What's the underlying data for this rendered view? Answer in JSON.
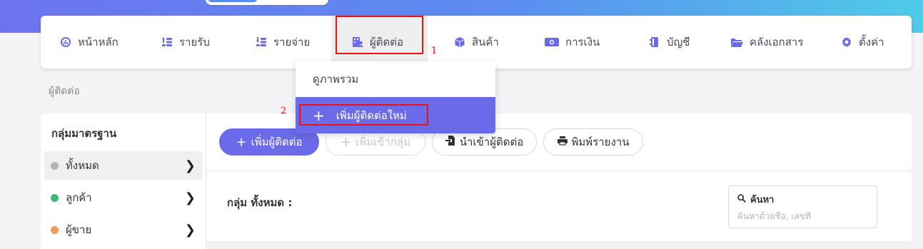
{
  "nav": {
    "items": [
      {
        "icon": "dashboard-icon",
        "label": "หน้าหลัก"
      },
      {
        "icon": "income-icon",
        "label": "รายรับ"
      },
      {
        "icon": "expense-icon",
        "label": "รายจ่าย"
      },
      {
        "icon": "contacts-icon",
        "label": "ผู้ติดต่อ"
      },
      {
        "icon": "product-box-icon",
        "label": "สินค้า"
      },
      {
        "icon": "money-icon",
        "label": "การเงิน"
      },
      {
        "icon": "ledger-icon",
        "label": "บัญชี"
      },
      {
        "icon": "folder-icon",
        "label": "คลังเอกสาร"
      },
      {
        "icon": "gear-icon",
        "label": "ตั้งค่า"
      }
    ],
    "active_index": 3
  },
  "dropdown": {
    "overview": "ดูภาพรวม",
    "add_new": "เพิ่มผู้ติดต่อใหม่",
    "add_icon": "+"
  },
  "annotations": {
    "step1": "1",
    "step2": "2",
    "color": "#e11111"
  },
  "breadcrumb": "ผู้ติดต่อ",
  "sidebar": {
    "title": "กลุ่มมาตรฐาน",
    "items": [
      {
        "label": "ทั้งหมด",
        "color": "#b4b4b4",
        "selected": true
      },
      {
        "label": "ลูกค้า",
        "color": "#3cba7a",
        "selected": false
      },
      {
        "label": "ผู้ขาย",
        "color": "#f59a4a",
        "selected": false
      }
    ]
  },
  "toolbar": {
    "add_contact": "เพิ่มผู้ติดต่อ",
    "add_to_group": "เพิ่มเข้ากลุ่ม",
    "import_contacts": "นำเข้าผู้ติดต่อ",
    "print_report": "พิมพ์รายงาน"
  },
  "group_label": "กลุ่ม ทั้งหมด :",
  "search": {
    "label": "ค้นหา",
    "placeholder": "ค้นหาด้วยชื่อ, เลขที่"
  },
  "colors": {
    "accent": "#6b6ae8",
    "header_start": "#6d73f0",
    "header_end": "#4fcbe8"
  }
}
